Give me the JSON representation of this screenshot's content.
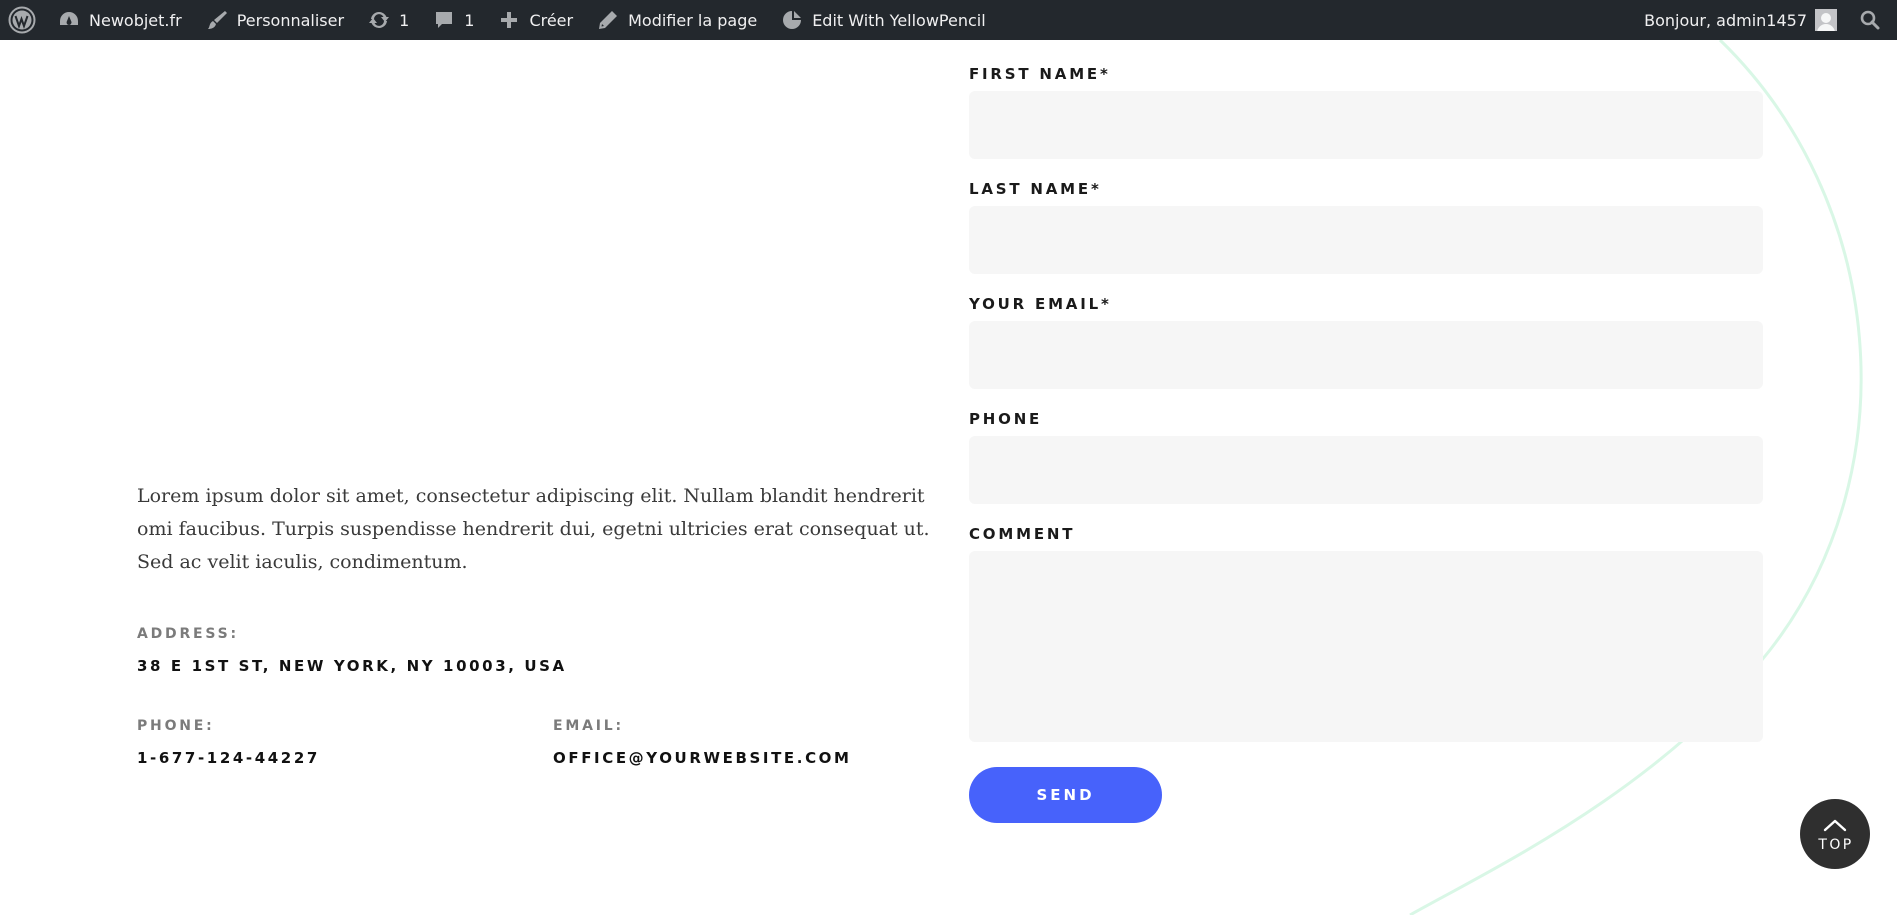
{
  "adminbar": {
    "site_name": "Newobjet.fr",
    "customize": "Personnaliser",
    "updates_count": "1",
    "comments_count": "1",
    "create": "Créer",
    "edit_page": "Modifier la page",
    "yellowpencil": "Edit With YellowPencil",
    "greeting": "Bonjour, admin1457"
  },
  "info": {
    "intro": "Lorem ipsum dolor sit amet, consectetur adipiscing elit. Nullam blandit hendrerit omi faucibus. Turpis suspendisse hendrerit  dui, egetni ultricies erat consequat ut. Sed ac velit iaculis, condimentum.",
    "address_label": "ADDRESS:",
    "address_value": "38 E 1ST ST, NEW YORK, NY 10003, USA",
    "phone_label": "PHONE:",
    "phone_value": "1-677-124-44227",
    "email_label": "EMAIL:",
    "email_value": "OFFICE@YOURWEBSITE.COM"
  },
  "form": {
    "first_name_label": "FIRST NAME*",
    "first_name_value": "",
    "last_name_label": "LAST NAME*",
    "last_name_value": "",
    "email_label": "YOUR EMAIL*",
    "email_value": "",
    "phone_label": "PHONE",
    "phone_value": "",
    "comment_label": "COMMENT",
    "comment_value": "",
    "send_label": "SEND"
  },
  "back_to_top": {
    "label": "TOP"
  },
  "colors": {
    "adminbar_bg": "#23282d",
    "accent": "#4762fb",
    "input_bg": "#f6f6f6",
    "curve": "#d9f7e6"
  }
}
